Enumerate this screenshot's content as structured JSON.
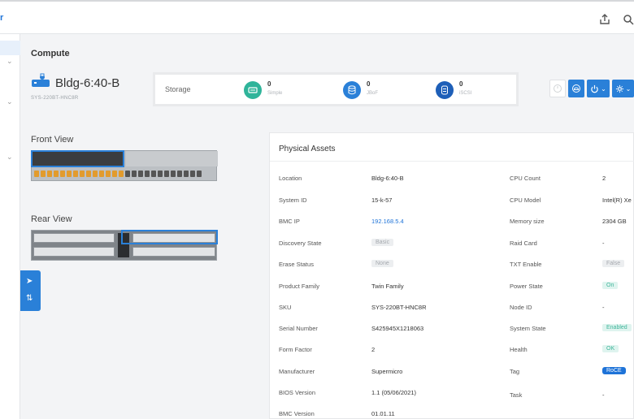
{
  "topbar": {
    "logo_fragment": "r",
    "icons": [
      "share-icon",
      "search-icon"
    ]
  },
  "sidebar": {
    "chevrons": [
      "chevron-down-icon",
      "chevron-down-icon",
      "chevron-down-icon"
    ]
  },
  "page": {
    "title": "Compute"
  },
  "device": {
    "name": "Bldg-6:40-B",
    "model": "SYS-220BT-HNC8R"
  },
  "storage": {
    "label": "Storage",
    "items": [
      {
        "value": "0",
        "name": "Simple",
        "icon": "drive-icon",
        "color": "#2fb49a"
      },
      {
        "value": "0",
        "name": "JBoF",
        "icon": "database-icon",
        "color": "#2a80d8"
      },
      {
        "value": "0",
        "name": "iSCSI",
        "icon": "disk-stack-icon",
        "color": "#1e5fb8"
      }
    ]
  },
  "actions": {
    "icons": [
      "power-disabled-icon",
      "cloud-icon",
      "power-icon",
      "settings-icon"
    ],
    "dropdown_glyph": "⌄"
  },
  "views": {
    "front_title": "Front View",
    "rear_title": "Rear View"
  },
  "assets": {
    "title": "Physical Assets",
    "left": [
      {
        "label": "Location",
        "value": "Bldg-6:40-B",
        "kind": "text"
      },
      {
        "label": "System ID",
        "value": "15-k-57",
        "kind": "text"
      },
      {
        "label": "BMC IP",
        "value": "192.168.5.4",
        "kind": "link"
      },
      {
        "label": "Discovery State",
        "value": "Basic",
        "kind": "grey"
      },
      {
        "label": "Erase Status",
        "value": "None",
        "kind": "grey"
      },
      {
        "label": "Product Family",
        "value": "Twin Family",
        "kind": "text"
      },
      {
        "label": "SKU",
        "value": "SYS-220BT-HNC8R",
        "kind": "text"
      },
      {
        "label": "Serial Number",
        "value": "S425945X1218063",
        "kind": "text"
      },
      {
        "label": "Form Factor",
        "value": "2",
        "kind": "text"
      },
      {
        "label": "Manufacturer",
        "value": "Supermicro",
        "kind": "text"
      },
      {
        "label": "BIOS Version",
        "value": "1.1 (05/06/2021)",
        "kind": "text"
      },
      {
        "label": "BMC Version",
        "value": "01.01.11",
        "kind": "text"
      }
    ],
    "right": [
      {
        "label": "CPU Count",
        "value": "2",
        "kind": "text"
      },
      {
        "label": "CPU Model",
        "value": "Intel(R) Xe",
        "kind": "text"
      },
      {
        "label": "Memory size",
        "value": "2304 GB",
        "kind": "text"
      },
      {
        "label": "Raid Card",
        "value": "-",
        "kind": "text"
      },
      {
        "label": "TXT Enable",
        "value": "False",
        "kind": "grey"
      },
      {
        "label": "Power State",
        "value": "On",
        "kind": "green"
      },
      {
        "label": "Node ID",
        "value": "-",
        "kind": "text"
      },
      {
        "label": "System State",
        "value": "Enabled",
        "kind": "green"
      },
      {
        "label": "Health",
        "value": "OK",
        "kind": "green"
      },
      {
        "label": "Tag",
        "value": "RoCE",
        "kind": "blue"
      },
      {
        "label": "Task",
        "value": "-",
        "kind": "text"
      }
    ]
  }
}
